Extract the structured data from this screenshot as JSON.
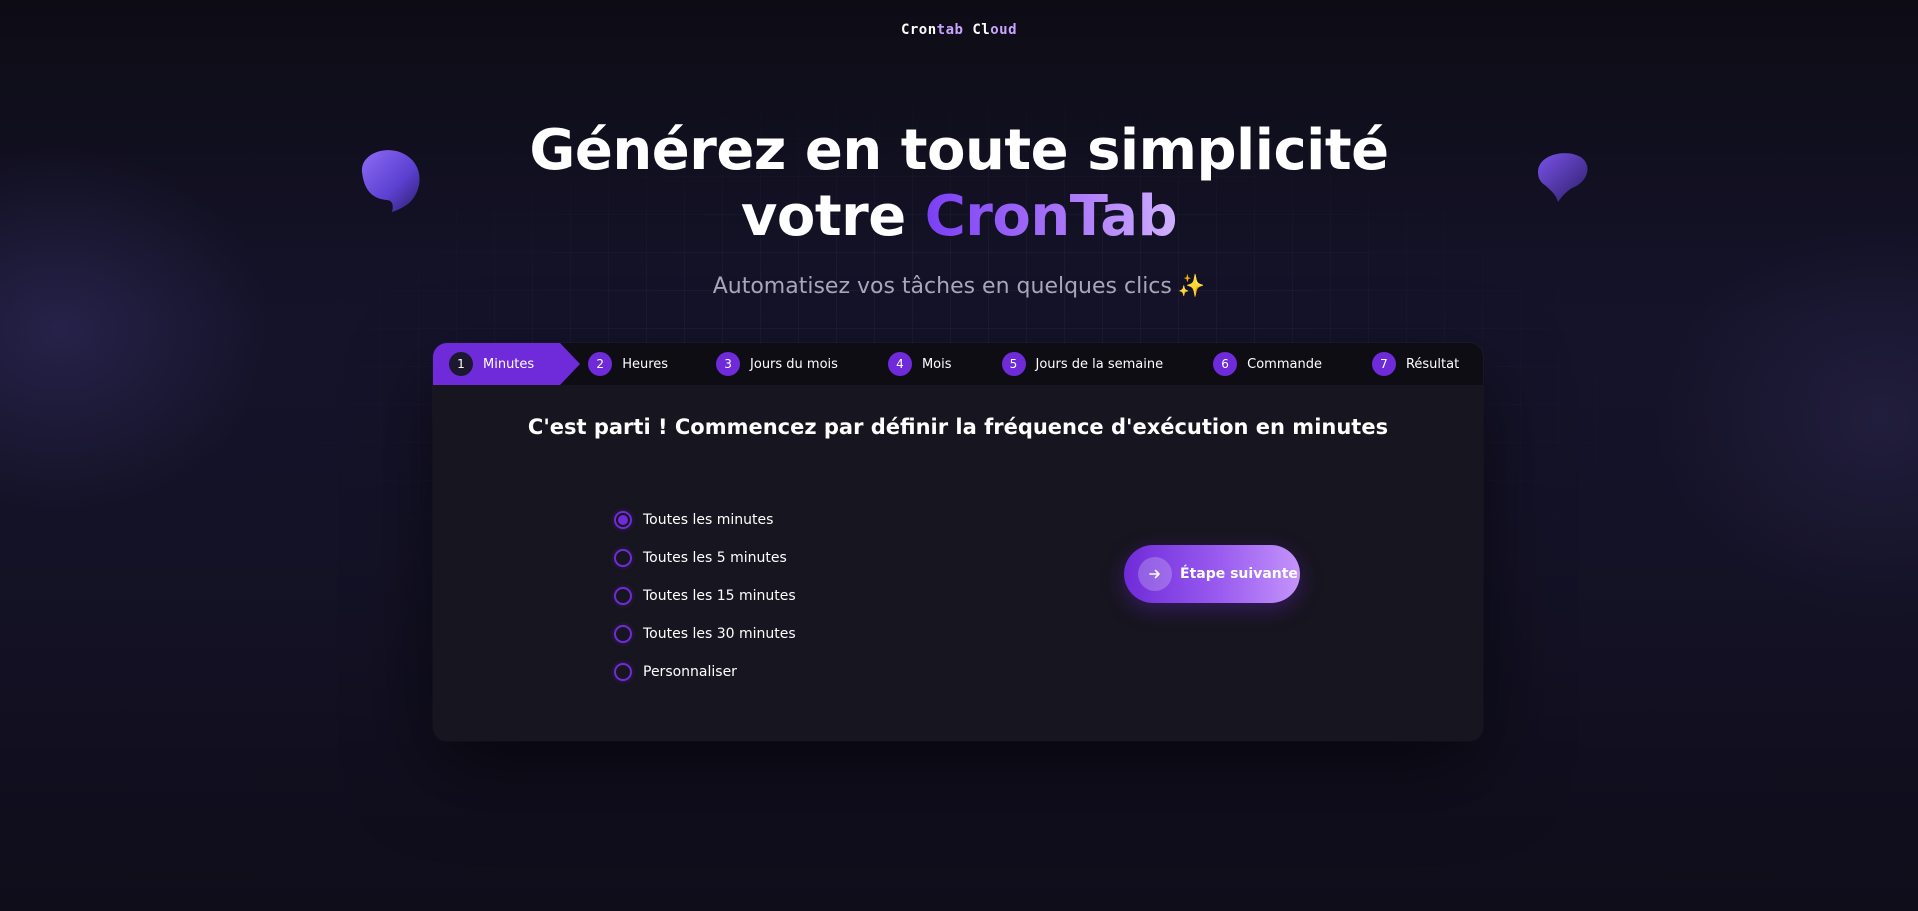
{
  "brand": {
    "part1": "Cron",
    "part2": "tab",
    "part3": " Cl",
    "part4": "oud"
  },
  "hero": {
    "title_line1": "Générez en toute simplicité",
    "title_line2_prefix": "votre ",
    "title_line2_accent": "CronTab",
    "subtitle": "Automatisez vos tâches en quelques clics",
    "subtitle_emoji": "✨"
  },
  "steps": [
    {
      "num": "1",
      "label": "Minutes",
      "active": true
    },
    {
      "num": "2",
      "label": "Heures",
      "active": false
    },
    {
      "num": "3",
      "label": "Jours du mois",
      "active": false
    },
    {
      "num": "4",
      "label": "Mois",
      "active": false
    },
    {
      "num": "5",
      "label": "Jours de la semaine",
      "active": false
    },
    {
      "num": "6",
      "label": "Commande",
      "active": false
    },
    {
      "num": "7",
      "label": "Résultat",
      "active": false
    }
  ],
  "question": "C'est parti ! Commencez par définir la fréquence d'exécution en minutes",
  "options": [
    {
      "label": "Toutes les minutes",
      "checked": true
    },
    {
      "label": "Toutes les 5 minutes",
      "checked": false
    },
    {
      "label": "Toutes les 15 minutes",
      "checked": false
    },
    {
      "label": "Toutes les 30 minutes",
      "checked": false
    },
    {
      "label": "Personnaliser",
      "checked": false
    }
  ],
  "next_button": {
    "label": "Étape suivante",
    "icon": "arrow-right-icon"
  },
  "colors": {
    "accent": "#6f2bd9",
    "background": "#0f0d1a",
    "card": "#17151f",
    "tabbar": "#0e0d14"
  }
}
